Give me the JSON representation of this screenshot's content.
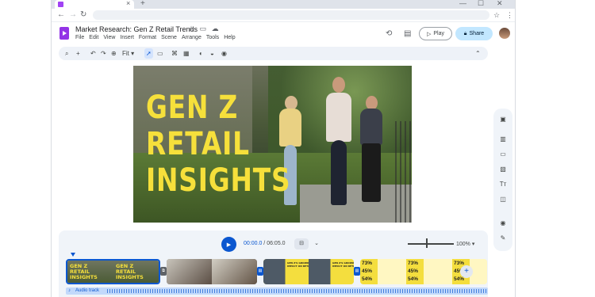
{
  "browser": {
    "tab_close": "×",
    "new_tab": "+",
    "win_min": "—",
    "win_max": "☐",
    "win_close": "✕"
  },
  "header": {
    "title": "Market Research: Gen Z Retail Trends",
    "menu": [
      "File",
      "Edit",
      "View",
      "Insert",
      "Format",
      "Scene",
      "Arrange",
      "Tools",
      "Help"
    ],
    "play_label": "Play",
    "share_label": "Share"
  },
  "toolbar": {
    "fit_label": "Fit"
  },
  "slide": {
    "headline_lines": [
      "GEN Z",
      "RETAIL",
      "INSIGHTS"
    ]
  },
  "playback": {
    "current_time": "00:00.0",
    "separator": " / ",
    "total_time": "06:05.0",
    "zoom": "100%"
  },
  "timeline": {
    "clip1_text": "GEN Z\nRETAIL\nINSIGHTS",
    "clip3_text": "GEN Z'S GROWING\nIMPACT ON RETAIL",
    "stats": [
      "73%",
      "45%",
      "54%"
    ],
    "audio_label": "Audio track"
  },
  "colors": {
    "accent": "#0b57d0",
    "headline_yellow": "#f6e03b",
    "app_purple": "#9334e6",
    "share_bg": "#c2e7ff"
  }
}
